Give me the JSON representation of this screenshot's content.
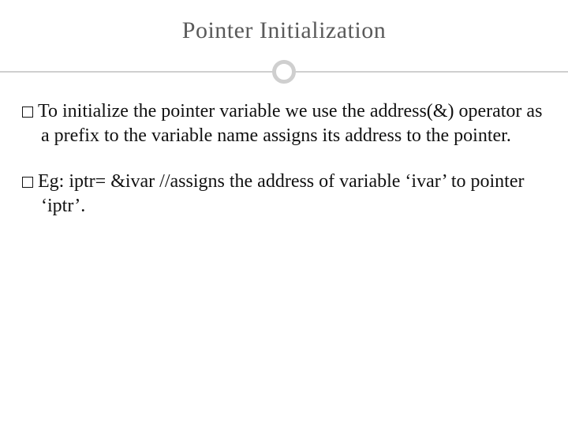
{
  "title": "Pointer Initialization",
  "paragraphs": [
    "To initialize the pointer variable we use the address(&) operator as a prefix to the variable name assigns its address to the pointer.",
    "Eg: iptr= &ivar //assigns the address of variable ‘ivar’ to pointer ‘iptr’."
  ]
}
